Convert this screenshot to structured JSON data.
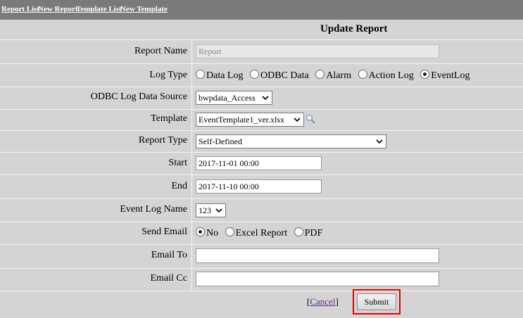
{
  "nav": {
    "report_list": "Report List",
    "new_report": "New Report",
    "template_list": "Template List",
    "new_template": "New Template"
  },
  "form": {
    "title": "Update Report",
    "report_name": {
      "label": "Report Name",
      "value": "Report"
    },
    "log_type": {
      "label": "Log Type",
      "options": [
        "Data Log",
        "ODBC Data",
        "Alarm",
        "Action Log",
        "EventLog"
      ],
      "selected": "EventLog"
    },
    "odbc_source": {
      "label": "ODBC Log Data Source",
      "value": "bwpdata_Access"
    },
    "template": {
      "label": "Template",
      "value": "EventTemplate1_ver.xlsx",
      "icon": "magnifier-icon"
    },
    "report_type": {
      "label": "Report Type",
      "value": "Self-Defined"
    },
    "start": {
      "label": "Start",
      "value": "2017-11-01 00:00"
    },
    "end": {
      "label": "End",
      "value": "2017-11-10 00:00"
    },
    "event_log_name": {
      "label": "Event Log Name",
      "value": "123"
    },
    "send_email": {
      "label": "Send Email",
      "options": [
        "No",
        "Excel Report",
        "PDF"
      ],
      "selected": "No"
    },
    "email_to": {
      "label": "Email To",
      "value": ""
    },
    "email_cc": {
      "label": "Email Cc",
      "value": ""
    },
    "cancel_label": "Cancel",
    "submit_label": "Submit"
  }
}
